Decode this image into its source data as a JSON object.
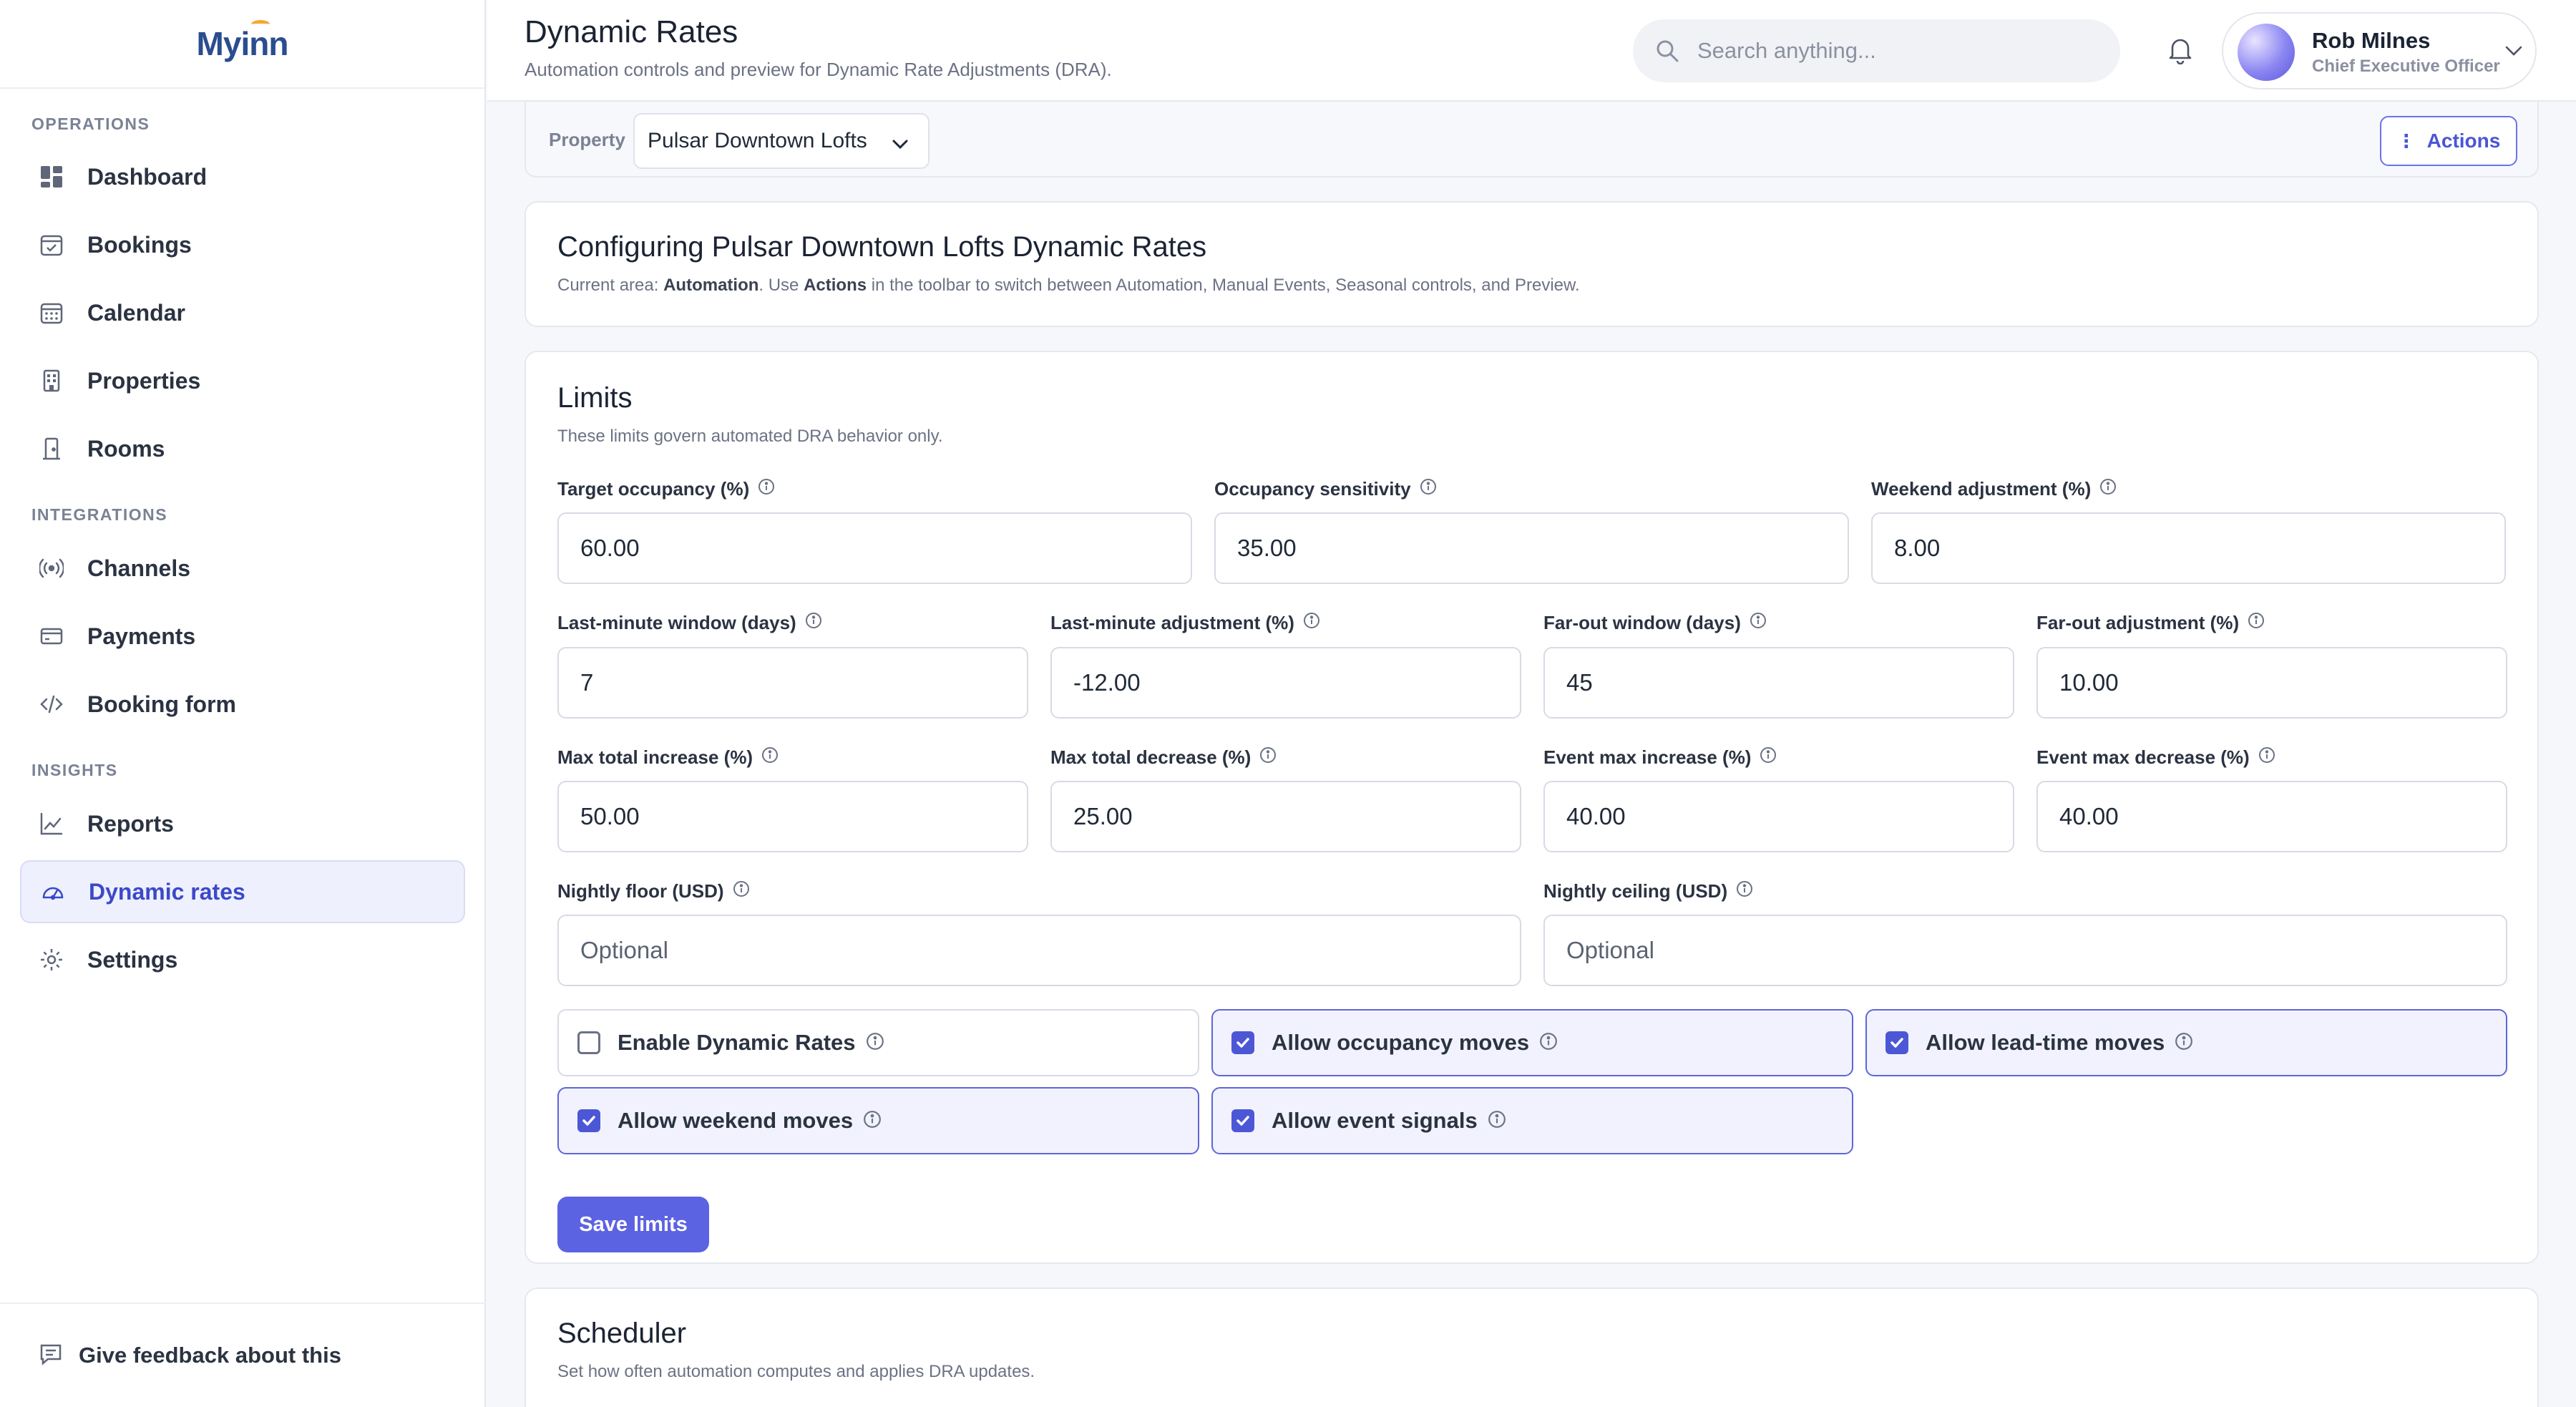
{
  "app": {
    "logo": "Myinn"
  },
  "sidebar": {
    "sections": {
      "operations": "OPERATIONS",
      "integrations": "INTEGRATIONS",
      "insights": "INSIGHTS"
    },
    "items": {
      "dashboard": "Dashboard",
      "bookings": "Bookings",
      "calendar": "Calendar",
      "properties": "Properties",
      "rooms": "Rooms",
      "channels": "Channels",
      "payments": "Payments",
      "booking_form": "Booking form",
      "reports": "Reports",
      "dynamic_rates": "Dynamic rates",
      "settings": "Settings"
    },
    "active": "Dynamic rates",
    "feedback": "Give feedback about this"
  },
  "header": {
    "title": "Dynamic Rates",
    "subtitle": "Automation controls and preview for Dynamic Rate Adjustments (DRA).",
    "search_placeholder": "Search anything...",
    "user_name": "Rob Milnes",
    "user_role": "Chief Executive Officer"
  },
  "toolbar": {
    "property_label": "Property",
    "property_value": "Pulsar Downtown Lofts",
    "actions_label": "Actions"
  },
  "config_card": {
    "title": "Configuring Pulsar Downtown Lofts Dynamic Rates",
    "desc_prefix": "Current area: ",
    "desc_area": "Automation",
    "desc_mid": ". Use ",
    "desc_actions": "Actions",
    "desc_suffix": " in the toolbar to switch between Automation, Manual Events, Seasonal controls, and Preview."
  },
  "limits": {
    "title": "Limits",
    "desc": "These limits govern automated DRA behavior only.",
    "fields": {
      "target_occupancy": {
        "label": "Target occupancy (%)",
        "value": "60.00"
      },
      "occupancy_sensitivity": {
        "label": "Occupancy sensitivity",
        "value": "35.00"
      },
      "weekend_adjustment": {
        "label": "Weekend adjustment (%)",
        "value": "8.00"
      },
      "last_minute_window": {
        "label": "Last-minute window (days)",
        "value": "7"
      },
      "last_minute_adjustment": {
        "label": "Last-minute adjustment (%)",
        "value": "-12.00"
      },
      "far_out_window": {
        "label": "Far-out window (days)",
        "value": "45"
      },
      "far_out_adjustment": {
        "label": "Far-out adjustment (%)",
        "value": "10.00"
      },
      "max_total_increase": {
        "label": "Max total increase (%)",
        "value": "50.00"
      },
      "max_total_decrease": {
        "label": "Max total decrease (%)",
        "value": "25.00"
      },
      "event_max_increase": {
        "label": "Event max increase (%)",
        "value": "40.00"
      },
      "event_max_decrease": {
        "label": "Event max decrease (%)",
        "value": "40.00"
      },
      "nightly_floor": {
        "label": "Nightly floor (USD)",
        "placeholder": "Optional"
      },
      "nightly_ceiling": {
        "label": "Nightly ceiling (USD)",
        "placeholder": "Optional"
      }
    },
    "toggles": {
      "enable_dynamic_rates": {
        "label": "Enable Dynamic Rates",
        "checked": false
      },
      "allow_occupancy_moves": {
        "label": "Allow occupancy moves",
        "checked": true
      },
      "allow_lead_time_moves": {
        "label": "Allow lead-time moves",
        "checked": true
      },
      "allow_weekend_moves": {
        "label": "Allow weekend moves",
        "checked": true
      },
      "allow_event_signals": {
        "label": "Allow event signals",
        "checked": true
      }
    },
    "save_label": "Save limits"
  },
  "scheduler": {
    "title": "Scheduler",
    "desc": "Set how often automation computes and applies DRA updates."
  },
  "colors": {
    "accent": "#5c63e2",
    "active_nav_bg": "#eef0fd",
    "checked_bg": "#f1f2fd"
  },
  "icons": {
    "dashboard": "dashboard-icon",
    "bookings": "bookings-icon",
    "calendar": "calendar-icon",
    "properties": "building-icon",
    "rooms": "door-icon",
    "channels": "broadcast-icon",
    "payments": "credit-card-icon",
    "booking_form": "code-icon",
    "reports": "chart-line-icon",
    "dynamic_rates": "gauge-icon",
    "settings": "gear-icon"
  }
}
